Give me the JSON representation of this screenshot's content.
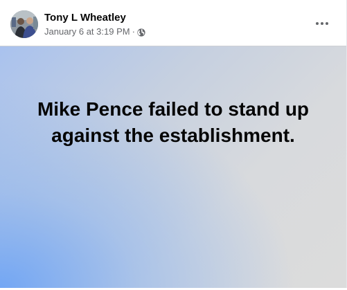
{
  "post": {
    "author": "Tony L Wheatley",
    "timestamp": "January 6 at 3:19 PM",
    "separator": "·",
    "audience_icon": "globe-icon",
    "more_icon": "more-options-icon",
    "text": "Mike Pence failed to stand up against the establishment."
  },
  "colors": {
    "text_primary": "#050505",
    "text_secondary": "#65676b",
    "gradient_blue": "#6ea4f5",
    "gradient_gray": "#dcdcdc"
  }
}
